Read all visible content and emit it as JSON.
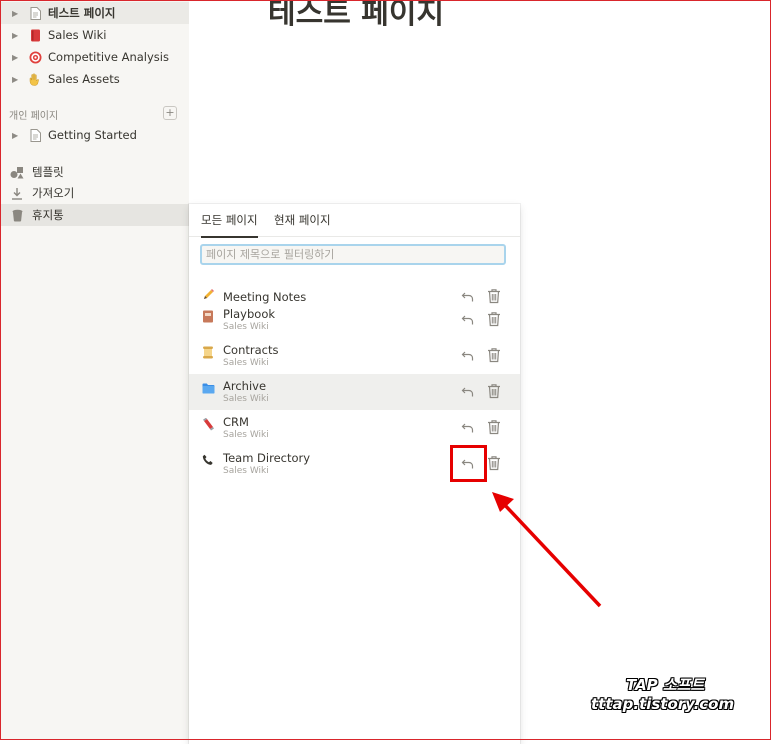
{
  "sidebar": {
    "pages": [
      {
        "label": "테스트 페이지",
        "icon": "page-icon",
        "selected": true
      },
      {
        "label": "Sales Wiki",
        "icon": "red-book-icon"
      },
      {
        "label": "Competitive Analysis",
        "icon": "target-icon"
      },
      {
        "label": "Sales Assets",
        "icon": "hand-icon"
      }
    ],
    "private_section": "개인 페이지",
    "add_symbol": "+",
    "private_pages": [
      {
        "label": "Getting Started",
        "icon": "page-icon"
      }
    ],
    "tools": {
      "templates": "템플릿",
      "import": "가져오기",
      "trash": "휴지통"
    }
  },
  "page": {
    "title": "테스트 페이지"
  },
  "trash_popup": {
    "tabs": {
      "all": "모든 페이지",
      "current": "현재 페이지"
    },
    "filter_placeholder": "페이지 제목으로 필터링하기",
    "items": [
      {
        "title": "Meeting Notes",
        "subtitle": "",
        "icon": "pencil-icon"
      },
      {
        "title": "Playbook",
        "subtitle": "Sales Wiki",
        "icon": "notebook-icon"
      },
      {
        "title": "Contracts",
        "subtitle": "Sales Wiki",
        "icon": "scroll-icon"
      },
      {
        "title": "Archive",
        "subtitle": "Sales Wiki",
        "icon": "folder-icon",
        "highlighted": true
      },
      {
        "title": "CRM",
        "subtitle": "Sales Wiki",
        "icon": "magnet-icon"
      },
      {
        "title": "Team Directory",
        "subtitle": "Sales Wiki",
        "icon": "phone-icon"
      }
    ]
  },
  "watermark": {
    "line1": "TAP 소프트",
    "line2": "tttap.tistory.com"
  },
  "colors": {
    "sidebar_bg": "#f7f6f3",
    "highlight_row": "#efefed",
    "annotation_red": "#e60000",
    "filter_border": "#a9d4ec"
  }
}
